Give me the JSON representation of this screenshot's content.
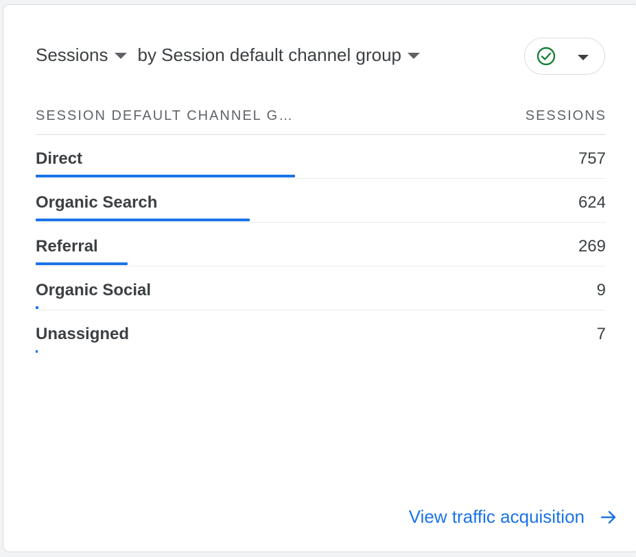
{
  "header": {
    "metric_label": "Sessions",
    "dimension_label": "by Session default channel group"
  },
  "status_button": {
    "icon": "check-circle-icon",
    "icon_color": "#188038"
  },
  "table": {
    "col_dimension": "SESSION DEFAULT CHANNEL G…",
    "col_metric": "SESSIONS",
    "bar_color": "#1a73e8",
    "rows": [
      {
        "label": "Direct",
        "value": "757",
        "sessions": 757
      },
      {
        "label": "Organic Search",
        "value": "624",
        "sessions": 624
      },
      {
        "label": "Referral",
        "value": "269",
        "sessions": 269
      },
      {
        "label": "Organic Social",
        "value": "9",
        "sessions": 9
      },
      {
        "label": "Unassigned",
        "value": "7",
        "sessions": 7
      }
    ]
  },
  "footer": {
    "link_label": "View traffic acquisition",
    "link_icon": "arrow-right-icon"
  }
}
